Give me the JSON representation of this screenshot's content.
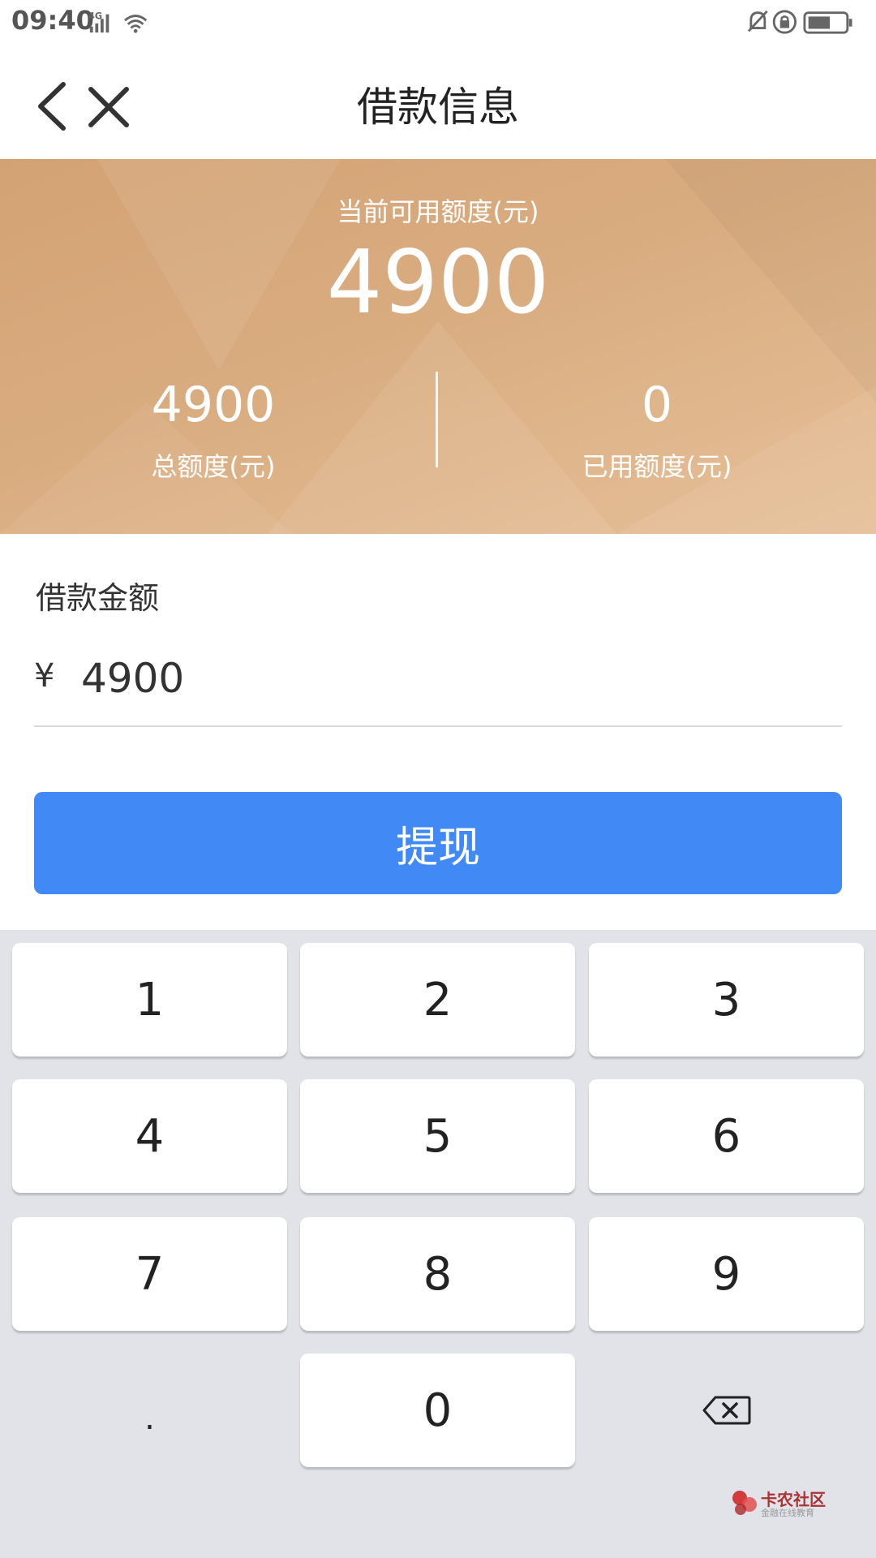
{
  "status_bar": {
    "time": "09:40",
    "network": "4G",
    "icons": [
      "signal-icon",
      "wifi-icon",
      "mute-bell-icon",
      "rotation-lock-icon",
      "battery-icon"
    ]
  },
  "nav": {
    "title": "借款信息",
    "back_icon": "chevron-left-icon",
    "close_icon": "close-icon"
  },
  "quota": {
    "available_label": "当前可用额度(元)",
    "available_value": "4900",
    "total_value": "4900",
    "total_label": "总额度(元)",
    "used_value": "0",
    "used_label": "已用额度(元)"
  },
  "loan": {
    "amount_label": "借款金额",
    "currency_symbol": "¥",
    "amount_value": "4900"
  },
  "withdraw_button": {
    "label": "提现"
  },
  "keypad": {
    "keys": [
      "1",
      "2",
      "3",
      "4",
      "5",
      "6",
      "7",
      "8",
      "9",
      ".",
      "0"
    ],
    "backspace_icon": "backspace-icon"
  },
  "watermark": {
    "text": "卡农社区",
    "sub": "金融在线教育"
  },
  "colors": {
    "banner_start": "#d3a274",
    "banner_end": "#e6c098",
    "button_blue": "#4189f5",
    "keypad_bg": "#e1e3e8"
  }
}
